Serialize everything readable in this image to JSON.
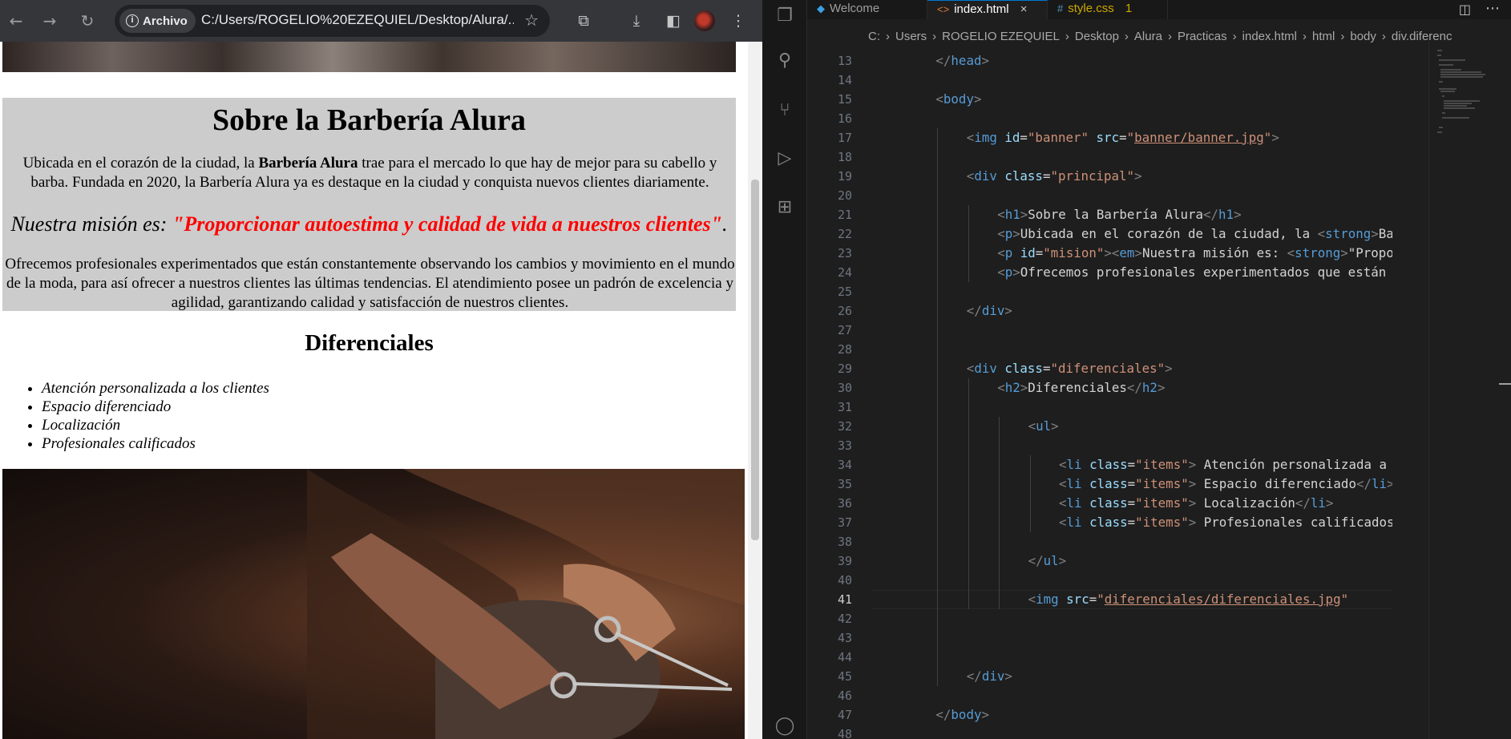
{
  "browser": {
    "site_chip": "Archivo",
    "url": "C:/Users/ROGELIO%20EZEQUIEL/Desktop/Alura/...",
    "page": {
      "h1": "Sobre la Barbería Alura",
      "p1_before": "Ubicada en el corazón de la ciudad, la ",
      "p1_strong": "Barbería Alura",
      "p1_after": " trae para el mercado lo que hay de mejor para su cabello y barba. Fundada en 2020, la Barbería Alura ya es destaque en la ciudad y conquista nuevos clientes diariamente.",
      "mision_intro": "Nuestra misión es: ",
      "mision_strong": "\"Proporcionar autoestima y calidad de vida a nuestros clientes\"",
      "mision_end": ".",
      "p3": "Ofrecemos profesionales experimentados que están constantemente observando los cambios y movimiento en el mundo de la moda, para así ofrecer a nuestros clientes las últimas tendencias. El atendimiento posee un padrón de excelencia y agilidad, garantizando calidad y satisfacción de nuestros clientes.",
      "h2": "Diferenciales",
      "items": [
        "Atención personalizada a los clientes",
        "Espacio diferenciado",
        "Localización",
        "Profesionales calificados"
      ]
    }
  },
  "editor": {
    "tabs": [
      {
        "label": "Welcome",
        "icon": "vscode-logo-icon",
        "badge": ""
      },
      {
        "label": "index.html",
        "icon": "html-file-icon",
        "badge": "×"
      },
      {
        "label": "style.css",
        "icon": "css-file-icon",
        "badge": "1"
      }
    ],
    "breadcrumbs": [
      "C:",
      "Users",
      "ROGELIO EZEQUIEL",
      "Desktop",
      "Alura",
      "Practicas",
      "index.html",
      "html",
      "body",
      "div.diferenc"
    ],
    "current_line": 41,
    "lines": [
      {
        "n": 13,
        "indent": 1,
        "tokens": [
          [
            "p",
            "</"
          ],
          [
            "t",
            "head"
          ],
          [
            "p",
            ">"
          ]
        ]
      },
      {
        "n": 14,
        "indent": 0,
        "tokens": []
      },
      {
        "n": 15,
        "indent": 1,
        "tokens": [
          [
            "p",
            "<"
          ],
          [
            "t",
            "body"
          ],
          [
            "p",
            ">"
          ]
        ]
      },
      {
        "n": 16,
        "indent": 0,
        "tokens": []
      },
      {
        "n": 17,
        "indent": 2,
        "tokens": [
          [
            "p",
            "<"
          ],
          [
            "t",
            "img"
          ],
          [
            "x",
            " "
          ],
          [
            "a",
            "id"
          ],
          [
            "x",
            "="
          ],
          [
            "s",
            "\"banner\""
          ],
          [
            "x",
            " "
          ],
          [
            "a",
            "src"
          ],
          [
            "x",
            "="
          ],
          [
            "s",
            "\""
          ],
          [
            "u",
            "banner/banner.jpg"
          ],
          [
            "s",
            "\""
          ],
          [
            "p",
            ">"
          ]
        ]
      },
      {
        "n": 18,
        "indent": 0,
        "tokens": []
      },
      {
        "n": 19,
        "indent": 2,
        "tokens": [
          [
            "p",
            "<"
          ],
          [
            "t",
            "div"
          ],
          [
            "x",
            " "
          ],
          [
            "a",
            "class"
          ],
          [
            "x",
            "="
          ],
          [
            "s",
            "\"principal\""
          ],
          [
            "p",
            ">"
          ]
        ]
      },
      {
        "n": 20,
        "indent": 0,
        "tokens": []
      },
      {
        "n": 21,
        "indent": 3,
        "tokens": [
          [
            "p",
            "<"
          ],
          [
            "t",
            "h1"
          ],
          [
            "p",
            ">"
          ],
          [
            "x",
            "Sobre la Barbería Alura"
          ],
          [
            "p",
            "</"
          ],
          [
            "t",
            "h1"
          ],
          [
            "p",
            ">"
          ]
        ]
      },
      {
        "n": 22,
        "indent": 3,
        "tokens": [
          [
            "p",
            "<"
          ],
          [
            "t",
            "p"
          ],
          [
            "p",
            ">"
          ],
          [
            "x",
            "Ubicada en el corazón de la ciudad, la "
          ],
          [
            "p",
            "<"
          ],
          [
            "t",
            "strong"
          ],
          [
            "p",
            ">"
          ],
          [
            "x",
            "Barbería Alura"
          ]
        ]
      },
      {
        "n": 23,
        "indent": 3,
        "tokens": [
          [
            "p",
            "<"
          ],
          [
            "t",
            "p"
          ],
          [
            "x",
            " "
          ],
          [
            "a",
            "id"
          ],
          [
            "x",
            "="
          ],
          [
            "s",
            "\"mision\""
          ],
          [
            "p",
            ">"
          ],
          [
            "p",
            "<"
          ],
          [
            "t",
            "em"
          ],
          [
            "p",
            ">"
          ],
          [
            "x",
            "Nuestra misión es: "
          ],
          [
            "p",
            "<"
          ],
          [
            "t",
            "strong"
          ],
          [
            "p",
            ">"
          ],
          [
            "x",
            "\"Proporcionar autoestima"
          ]
        ]
      },
      {
        "n": 24,
        "indent": 3,
        "tokens": [
          [
            "p",
            "<"
          ],
          [
            "t",
            "p"
          ],
          [
            "p",
            ">"
          ],
          [
            "x",
            "Ofrecemos profesionales experimentados que están constantemente"
          ]
        ]
      },
      {
        "n": 25,
        "indent": 0,
        "tokens": []
      },
      {
        "n": 26,
        "indent": 2,
        "tokens": [
          [
            "p",
            "</"
          ],
          [
            "t",
            "div"
          ],
          [
            "p",
            ">"
          ]
        ]
      },
      {
        "n": 27,
        "indent": 0,
        "tokens": []
      },
      {
        "n": 28,
        "indent": 0,
        "tokens": []
      },
      {
        "n": 29,
        "indent": 2,
        "tokens": [
          [
            "p",
            "<"
          ],
          [
            "t",
            "div"
          ],
          [
            "x",
            " "
          ],
          [
            "a",
            "class"
          ],
          [
            "x",
            "="
          ],
          [
            "s",
            "\"diferenciales\""
          ],
          [
            "p",
            ">"
          ]
        ]
      },
      {
        "n": 30,
        "indent": 3,
        "tokens": [
          [
            "p",
            "<"
          ],
          [
            "t",
            "h2"
          ],
          [
            "p",
            ">"
          ],
          [
            "x",
            "Diferenciales"
          ],
          [
            "p",
            "</"
          ],
          [
            "t",
            "h2"
          ],
          [
            "p",
            ">"
          ]
        ]
      },
      {
        "n": 31,
        "indent": 0,
        "tokens": []
      },
      {
        "n": 32,
        "indent": 4,
        "tokens": [
          [
            "p",
            "<"
          ],
          [
            "t",
            "ul"
          ],
          [
            "p",
            ">"
          ]
        ]
      },
      {
        "n": 33,
        "indent": 0,
        "tokens": []
      },
      {
        "n": 34,
        "indent": 5,
        "tokens": [
          [
            "p",
            "<"
          ],
          [
            "t",
            "li"
          ],
          [
            "x",
            " "
          ],
          [
            "a",
            "class"
          ],
          [
            "x",
            "="
          ],
          [
            "s",
            "\"items\""
          ],
          [
            "p",
            ">"
          ],
          [
            "x",
            " Atención personalizada a los clientes"
          ]
        ]
      },
      {
        "n": 35,
        "indent": 5,
        "tokens": [
          [
            "p",
            "<"
          ],
          [
            "t",
            "li"
          ],
          [
            "x",
            " "
          ],
          [
            "a",
            "class"
          ],
          [
            "x",
            "="
          ],
          [
            "s",
            "\"items\""
          ],
          [
            "p",
            ">"
          ],
          [
            "x",
            " Espacio diferenciado"
          ],
          [
            "p",
            "</"
          ],
          [
            "t",
            "li"
          ],
          [
            "p",
            ">"
          ]
        ]
      },
      {
        "n": 36,
        "indent": 5,
        "tokens": [
          [
            "p",
            "<"
          ],
          [
            "t",
            "li"
          ],
          [
            "x",
            " "
          ],
          [
            "a",
            "class"
          ],
          [
            "x",
            "="
          ],
          [
            "s",
            "\"items\""
          ],
          [
            "p",
            ">"
          ],
          [
            "x",
            " Localización"
          ],
          [
            "p",
            "</"
          ],
          [
            "t",
            "li"
          ],
          [
            "p",
            ">"
          ]
        ]
      },
      {
        "n": 37,
        "indent": 5,
        "tokens": [
          [
            "p",
            "<"
          ],
          [
            "t",
            "li"
          ],
          [
            "x",
            " "
          ],
          [
            "a",
            "class"
          ],
          [
            "x",
            "="
          ],
          [
            "s",
            "\"items\""
          ],
          [
            "p",
            ">"
          ],
          [
            "x",
            " Profesionales calificados"
          ],
          [
            "p",
            "</"
          ],
          [
            "t",
            "li"
          ],
          [
            "p",
            ">"
          ]
        ]
      },
      {
        "n": 38,
        "indent": 0,
        "tokens": []
      },
      {
        "n": 39,
        "indent": 4,
        "tokens": [
          [
            "p",
            "</"
          ],
          [
            "t",
            "ul"
          ],
          [
            "p",
            ">"
          ]
        ]
      },
      {
        "n": 40,
        "indent": 0,
        "tokens": []
      },
      {
        "n": 41,
        "indent": 4,
        "tokens": [
          [
            "p",
            "<"
          ],
          [
            "t",
            "img"
          ],
          [
            "x",
            " "
          ],
          [
            "a",
            "src"
          ],
          [
            "x",
            "="
          ],
          [
            "s",
            "\""
          ],
          [
            "u",
            "diferenciales/diferenciales.jpg"
          ],
          [
            "s",
            "\""
          ]
        ]
      },
      {
        "n": 42,
        "indent": 0,
        "tokens": []
      },
      {
        "n": 43,
        "indent": 0,
        "tokens": []
      },
      {
        "n": 44,
        "indent": 0,
        "tokens": []
      },
      {
        "n": 45,
        "indent": 2,
        "tokens": [
          [
            "p",
            "</"
          ],
          [
            "t",
            "div"
          ],
          [
            "p",
            ">"
          ]
        ]
      },
      {
        "n": 46,
        "indent": 0,
        "tokens": []
      },
      {
        "n": 47,
        "indent": 1,
        "tokens": [
          [
            "p",
            "</"
          ],
          [
            "t",
            "body"
          ],
          [
            "p",
            ">"
          ]
        ]
      },
      {
        "n": 48,
        "indent": 0,
        "tokens": []
      }
    ]
  },
  "colors": {
    "tag": "#569cd6",
    "attribute": "#9cdcfe",
    "string": "#ce9178",
    "text": "#d4d4d4",
    "punctuation": "#808080",
    "mision_red": "#ff0000",
    "principal_bg": "#cccccc",
    "active_tab_accent": "#0078d4"
  }
}
